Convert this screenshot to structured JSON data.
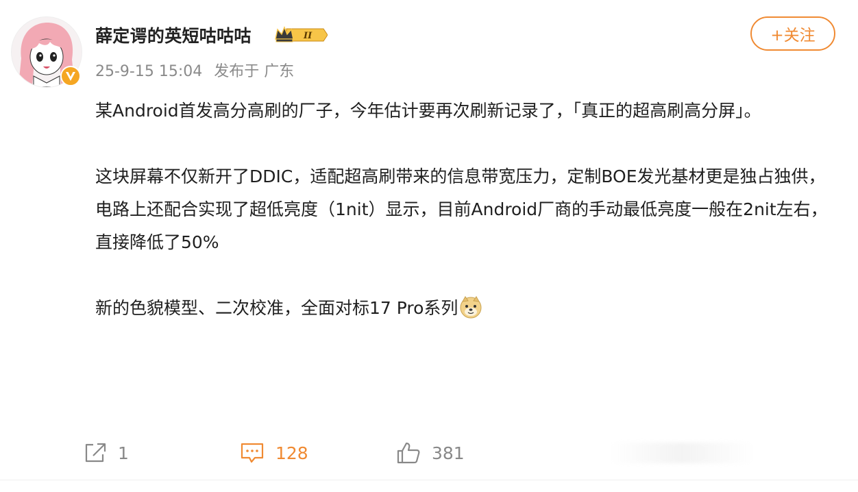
{
  "post": {
    "author": {
      "name": "薛定谔的英短咕咕咕",
      "level_badge": "II",
      "avatar": "anime-girl-avatar",
      "verified_icon": "v-verified-icon"
    },
    "meta": {
      "timestamp": "25-9-15 15:04",
      "location": "发布于 广东"
    },
    "follow_label": "+关注",
    "paragraphs": [
      "某Android首发高分高刷的厂子，今年估计要再次刷新记录了，「真正的超高刷高分屏」。",
      "这块屏幕不仅新开了DDIC，适配超高刷带来的信息带宽压力，定制BOE发光基材更是独占独供，电路上还配合实现了超低亮度（1nit）显示，目前Android厂商的手动最低亮度一般在2nit左右，直接降低了50%",
      "新的色貌模型、二次校准，全面对标17 Pro系列"
    ],
    "emoji": "doge-emoji",
    "actions": {
      "share_count": "1",
      "comment_count": "128",
      "like_count": "381"
    }
  },
  "colors": {
    "accent": "#f08a32",
    "muted": "#8a8a8a",
    "text": "#1f1f1f",
    "verified": "#f5a623"
  }
}
